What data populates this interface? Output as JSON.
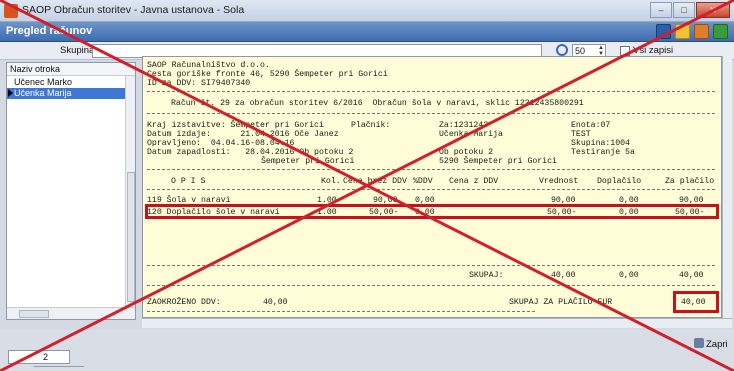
{
  "window": {
    "title": "SAOP Obračun storitev - Javna ustanova - Sola",
    "subtitle": "Pregled računov"
  },
  "filter": {
    "label": "Skupina",
    "input_value": "",
    "count_value": "50",
    "checkbox_label": "Vsi zapisi"
  },
  "students": {
    "header": "Naziv otroka",
    "rows": [
      "Učenec Marko",
      "Učenka Marija"
    ],
    "selected_index": 1
  },
  "invoice": {
    "company": "SAOP Računalništvo d.o.o.",
    "address": "Cesta goriške fronte 46, 5290 Šempeter pri Gorici",
    "vat_id": "ID za DDV: SI79407340",
    "heading": "Račun št. 29 za obračun storitev 6/2016  Obračun šola v naravi, sklic 12312435800291",
    "issue_place": "Kraj izstavitve: Šempeter pri Gorici",
    "issue_date": "Datum izdaje:      21.04.2016 Oče Janez",
    "service_period": "Opravljeno:  04.04.16-08.04.16",
    "due_date": "Datum zapadlosti:   28.04.2016 Ob potoku 2",
    "payer_city": "Šempeter pri Gorici",
    "payer_label": "Plačnik:",
    "for_label": "Za:1231243",
    "for_name": "Učenka Marija",
    "for_street": "Ob potoku 2",
    "for_city": "5290 Šempeter pri Gorici",
    "unit": "Enota:07",
    "test": "TEST",
    "group": "Skupina:1004",
    "testing": "Testiranje 5a",
    "columns": [
      "O P I S",
      "Kol.",
      "Cena brez DDV",
      "%DDV",
      "Cena z DDV",
      "Vrednost",
      "Doplačilo",
      "Za plačilo"
    ],
    "items": [
      {
        "desc": "119 Šola v naravi",
        "qty": "1.00",
        "price": "90,00",
        "vat": "0,00",
        "price_vat": "",
        "value": "90,00",
        "extra": "0,00",
        "pay": "90,00"
      },
      {
        "desc": "120 Doplačilo šole v naravi",
        "qty": "1.00",
        "price": "50,00-",
        "vat": "0,00",
        "price_vat": "",
        "value": "50,00-",
        "extra": "0,00",
        "pay": "50,00-"
      }
    ],
    "sum_label": "SKUPAJ:",
    "sum_value": "40,00",
    "sum_extra": "0,00",
    "sum_pay": "40,00",
    "vat_label": "ZAOKROŽENO DDV:",
    "vat_value": "40,00",
    "total_label": "SKUPAJ ZA PLAČILO EUR",
    "total_value": "40,00"
  },
  "footer": {
    "page": "2",
    "close_label": "Zapri"
  },
  "colors": {
    "title_blue": "#3d6cb0",
    "doc_bg": "#fffdd8",
    "highlight_red": "#c4121f",
    "selection_blue": "#3f78d4"
  }
}
